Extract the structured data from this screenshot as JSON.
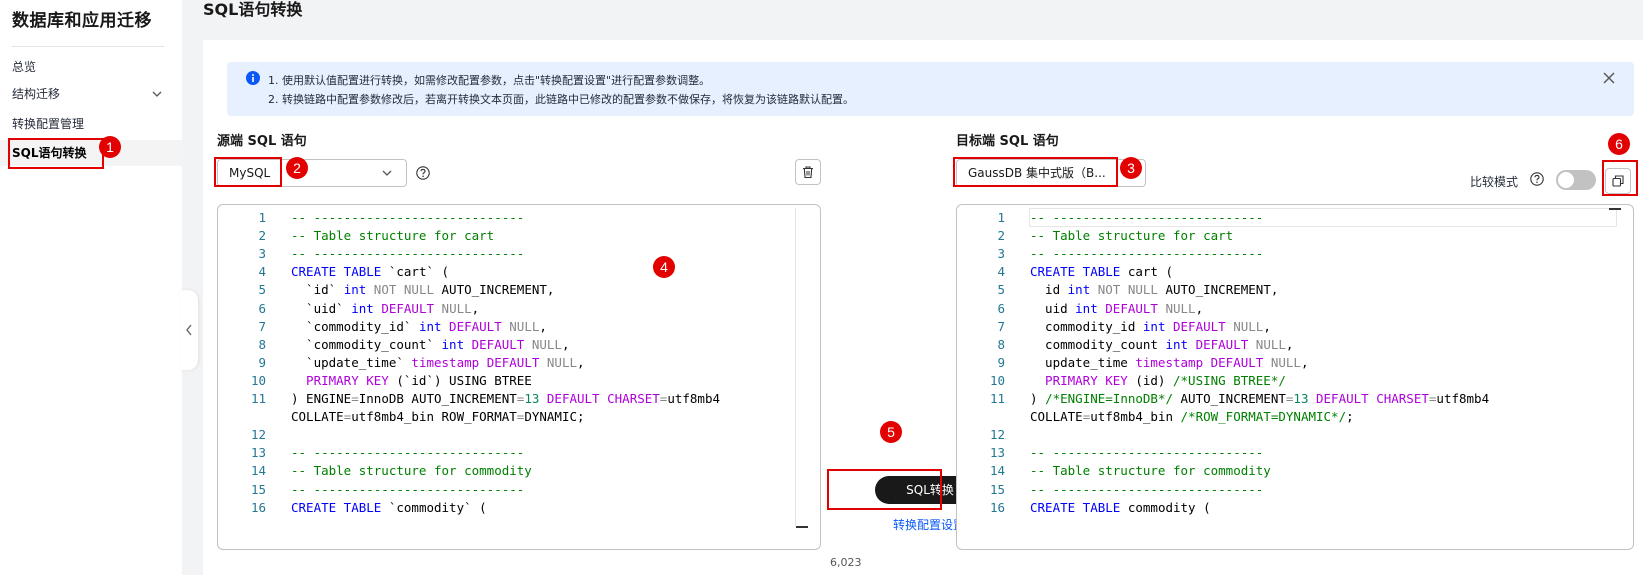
{
  "sidebar": {
    "title": "数据库和应用迁移",
    "items": [
      {
        "label": "总览"
      },
      {
        "label": "结构迁移"
      },
      {
        "label": "转换配置管理"
      },
      {
        "label": "SQL语句转换"
      }
    ]
  },
  "page": {
    "title": "SQL语句转换"
  },
  "banner": {
    "line1": "1. 使用默认值配置进行转换，如需修改配置参数，点击\"转换配置设置\"进行配置参数调整。",
    "line2": "2. 转换链路中配置参数修改后，若离开转换文本页面，此链路中已修改的配置参数不做保存，将恢复为该链路默认配置。"
  },
  "source": {
    "label": "源端 SQL 语句",
    "db": "MySQL",
    "char_count": "6,023"
  },
  "target": {
    "label": "目标端 SQL 语句",
    "db": "GaussDB 集中式版（B...",
    "compare_label": "比较模式",
    "compare_on": false
  },
  "actions": {
    "convert_label": "SQL转换",
    "settings_label": "转换配置设置"
  },
  "annotations": [
    "1",
    "2",
    "3",
    "4",
    "5",
    "6"
  ],
  "icons": {
    "info": "info-icon",
    "close": "close-icon",
    "help": "help-icon",
    "trash": "trash-icon",
    "copy": "copy-icon",
    "chevron": "chevron-down-icon",
    "collapse": "chevron-left-icon"
  },
  "colors": {
    "accent": "#0a59f7",
    "annotation": "#e30000",
    "button": "#191919"
  },
  "source_code": [
    {
      "n": "1",
      "t": [
        [
          "cm",
          "-- ----------------------------"
        ]
      ]
    },
    {
      "n": "2",
      "t": [
        [
          "cm",
          "-- Table structure for cart"
        ]
      ]
    },
    {
      "n": "3",
      "t": [
        [
          "cm",
          "-- ----------------------------"
        ]
      ]
    },
    {
      "n": "4",
      "t": [
        [
          "kw",
          "CREATE TABLE "
        ],
        [
          "txt",
          "`cart` ("
        ]
      ]
    },
    {
      "n": "5",
      "t": [
        [
          "txt",
          "  `id` "
        ],
        [
          "kw",
          "int "
        ],
        [
          "gray",
          "NOT NULL "
        ],
        [
          "txt",
          "AUTO_INCREMENT,"
        ]
      ]
    },
    {
      "n": "6",
      "t": [
        [
          "txt",
          "  `uid` "
        ],
        [
          "kw",
          "int "
        ],
        [
          "kw2",
          "DEFAULT "
        ],
        [
          "gray",
          "NULL"
        ],
        [
          "txt",
          ","
        ]
      ]
    },
    {
      "n": "7",
      "t": [
        [
          "txt",
          "  `commodity_id` "
        ],
        [
          "kw",
          "int "
        ],
        [
          "kw2",
          "DEFAULT "
        ],
        [
          "gray",
          "NULL"
        ],
        [
          "txt",
          ","
        ]
      ]
    },
    {
      "n": "8",
      "t": [
        [
          "txt",
          "  `commodity_count` "
        ],
        [
          "kw",
          "int "
        ],
        [
          "kw2",
          "DEFAULT "
        ],
        [
          "gray",
          "NULL"
        ],
        [
          "txt",
          ","
        ]
      ]
    },
    {
      "n": "9",
      "t": [
        [
          "txt",
          "  `update_time` "
        ],
        [
          "kw2",
          "timestamp "
        ],
        [
          "kw2",
          "DEFAULT "
        ],
        [
          "gray",
          "NULL"
        ],
        [
          "txt",
          ","
        ]
      ]
    },
    {
      "n": "10",
      "t": [
        [
          "kw2",
          "  PRIMARY KEY "
        ],
        [
          "txt",
          "(`id`) "
        ],
        [
          "txt",
          "USING BTREE"
        ]
      ]
    },
    {
      "n": "11",
      "t": [
        [
          "txt",
          ") ENGINE"
        ],
        [
          "gray",
          "="
        ],
        [
          "txt",
          "InnoDB AUTO_INCREMENT"
        ],
        [
          "gray",
          "="
        ],
        [
          "num",
          "13 "
        ],
        [
          "kw2",
          "DEFAULT CHARSET"
        ],
        [
          "gray",
          "="
        ],
        [
          "txt",
          "utf8mb4"
        ]
      ]
    },
    {
      "n": "",
      "t": [
        [
          "txt",
          "COLLATE"
        ],
        [
          "gray",
          "="
        ],
        [
          "txt",
          "utf8mb4_bin ROW_FORMAT"
        ],
        [
          "gray",
          "="
        ],
        [
          "txt",
          "DYNAMIC;"
        ]
      ]
    },
    {
      "n": "12",
      "t": []
    },
    {
      "n": "13",
      "t": [
        [
          "cm",
          "-- ----------------------------"
        ]
      ]
    },
    {
      "n": "14",
      "t": [
        [
          "cm",
          "-- Table structure for commodity"
        ]
      ]
    },
    {
      "n": "15",
      "t": [
        [
          "cm",
          "-- ----------------------------"
        ]
      ]
    },
    {
      "n": "16",
      "t": [
        [
          "kw",
          "CREATE TABLE "
        ],
        [
          "txt",
          "`commodity` ("
        ]
      ]
    }
  ],
  "target_code": [
    {
      "n": "1",
      "t": [
        [
          "cm",
          "-- ----------------------------"
        ]
      ]
    },
    {
      "n": "2",
      "t": [
        [
          "cm",
          "-- Table structure for cart"
        ]
      ]
    },
    {
      "n": "3",
      "t": [
        [
          "cm",
          "-- ----------------------------"
        ]
      ]
    },
    {
      "n": "4",
      "t": [
        [
          "kw",
          "CREATE TABLE "
        ],
        [
          "txt",
          "cart ("
        ]
      ]
    },
    {
      "n": "5",
      "t": [
        [
          "txt",
          "  id "
        ],
        [
          "kw",
          "int "
        ],
        [
          "gray",
          "NOT NULL "
        ],
        [
          "txt",
          "AUTO_INCREMENT,"
        ]
      ]
    },
    {
      "n": "6",
      "t": [
        [
          "txt",
          "  uid "
        ],
        [
          "kw",
          "int "
        ],
        [
          "kw2",
          "DEFAULT "
        ],
        [
          "gray",
          "NULL"
        ],
        [
          "txt",
          ","
        ]
      ]
    },
    {
      "n": "7",
      "t": [
        [
          "txt",
          "  commodity_id "
        ],
        [
          "kw",
          "int "
        ],
        [
          "kw2",
          "DEFAULT "
        ],
        [
          "gray",
          "NULL"
        ],
        [
          "txt",
          ","
        ]
      ]
    },
    {
      "n": "8",
      "t": [
        [
          "txt",
          "  commodity_count "
        ],
        [
          "kw",
          "int "
        ],
        [
          "kw2",
          "DEFAULT "
        ],
        [
          "gray",
          "NULL"
        ],
        [
          "txt",
          ","
        ]
      ]
    },
    {
      "n": "9",
      "t": [
        [
          "txt",
          "  update_time "
        ],
        [
          "kw2",
          "timestamp "
        ],
        [
          "kw2",
          "DEFAULT "
        ],
        [
          "gray",
          "NULL"
        ],
        [
          "txt",
          ","
        ]
      ]
    },
    {
      "n": "10",
      "t": [
        [
          "kw2",
          "  PRIMARY KEY "
        ],
        [
          "txt",
          "(id) "
        ],
        [
          "cm",
          "/*USING BTREE*/"
        ]
      ]
    },
    {
      "n": "11",
      "t": [
        [
          "txt",
          ") "
        ],
        [
          "cm",
          "/*ENGINE=InnoDB*/ "
        ],
        [
          "txt",
          "AUTO_INCREMENT"
        ],
        [
          "gray",
          "="
        ],
        [
          "num",
          "13 "
        ],
        [
          "kw2",
          "DEFAULT CHARSET"
        ],
        [
          "gray",
          "="
        ],
        [
          "txt",
          "utf8mb4"
        ]
      ]
    },
    {
      "n": "",
      "t": [
        [
          "txt",
          "COLLATE"
        ],
        [
          "gray",
          "="
        ],
        [
          "txt",
          "utf8mb4_bin "
        ],
        [
          "cm",
          "/*ROW_FORMAT=DYNAMIC*/"
        ],
        [
          "txt",
          ";"
        ]
      ]
    },
    {
      "n": "12",
      "t": []
    },
    {
      "n": "13",
      "t": [
        [
          "cm",
          "-- ----------------------------"
        ]
      ]
    },
    {
      "n": "14",
      "t": [
        [
          "cm",
          "-- Table structure for commodity"
        ]
      ]
    },
    {
      "n": "15",
      "t": [
        [
          "cm",
          "-- ----------------------------"
        ]
      ]
    },
    {
      "n": "16",
      "t": [
        [
          "kw",
          "CREATE TABLE "
        ],
        [
          "txt",
          "commodity ("
        ]
      ]
    }
  ]
}
